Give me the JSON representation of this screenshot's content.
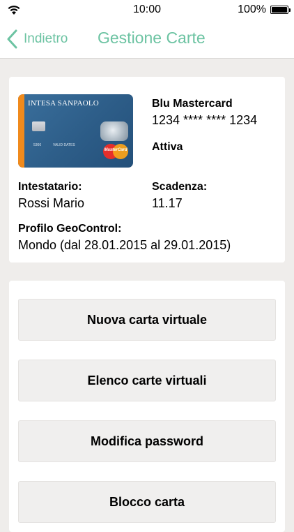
{
  "status_bar": {
    "time": "10:00",
    "battery": "100%"
  },
  "nav": {
    "back_label": "Indietro",
    "title": "Gestione Carte",
    "accent_color": "#6cc3a2"
  },
  "card": {
    "image": {
      "bank": "INTESA SANPAOLO",
      "network": "MasterCard",
      "small_1": "5366",
      "small_2": "VALID DATES"
    },
    "name": "Blu Mastercard",
    "number": "1234 **** **** 1234",
    "status": "Attiva",
    "holder_label": "Intestatario:",
    "holder": "Rossi Mario",
    "expiry_label": "Scadenza:",
    "expiry": "11.17",
    "geo_label": "Profilo GeoControl:",
    "geo_value": "Mondo (dal 28.01.2015 al 29.01.2015)"
  },
  "actions": [
    {
      "label": "Nuova carta virtuale"
    },
    {
      "label": "Elenco carte virtuali"
    },
    {
      "label": "Modifica password"
    },
    {
      "label": "Blocco carta"
    }
  ]
}
